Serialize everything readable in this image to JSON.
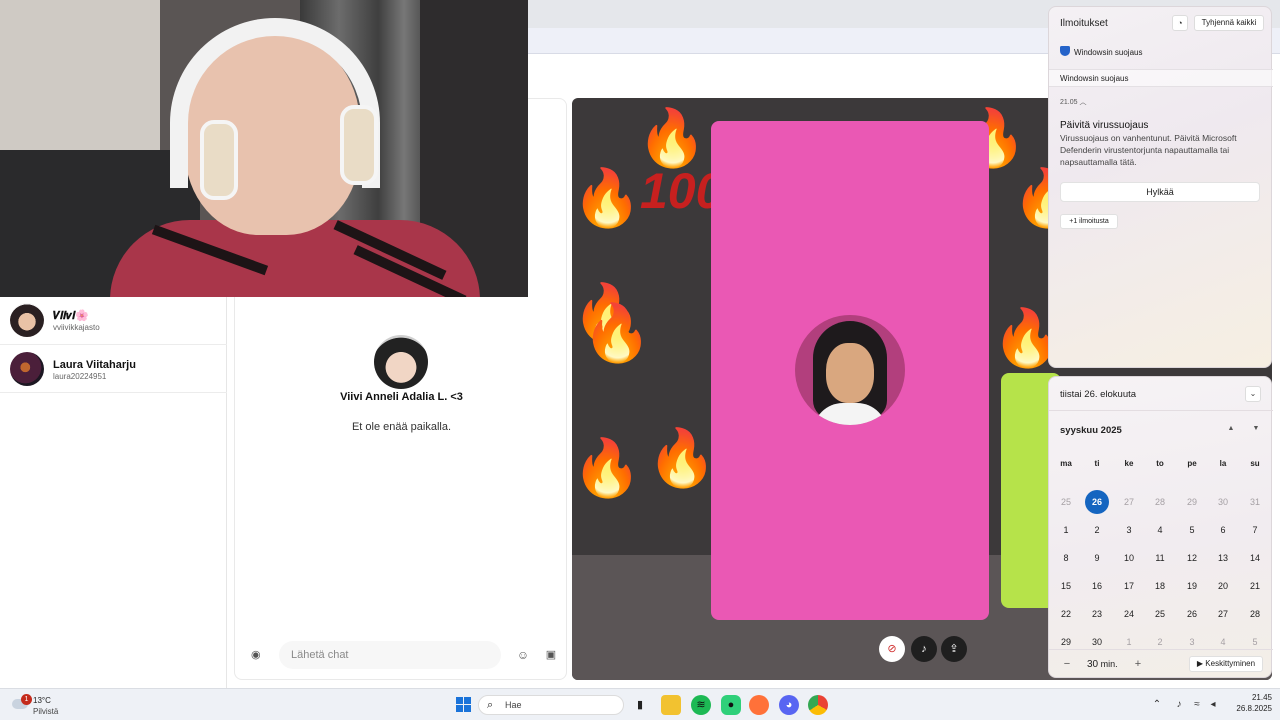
{
  "contacts": [
    {
      "name": "𝑽𝒊𝒊𝒗𝒊🌸",
      "handle": "vviivikkajasto"
    },
    {
      "name": "Laura Viitaharju",
      "handle": "laura20224951"
    }
  ],
  "chat": {
    "contact_name": "Viivi Anneli Adalia L. <3",
    "status": "Et ole enää paikalla.",
    "input_placeholder": "Lähetä chat"
  },
  "call": {
    "sticker_text": "100"
  },
  "notifications": {
    "title": "Ilmoitukset",
    "clear_all": "Tyhjennä kaikki",
    "app_name": "Windowsin suojaus",
    "group_name": "Windowsin suojaus",
    "time": "21.05",
    "heading": "Päivitä virussuojaus",
    "body": "Virussuojaus on vanhentunut. Päivitä Microsoft Defenderin virustentorjunta napauttamalla tai napsauttamalla tätä.",
    "dismiss": "Hylkää",
    "more": "+1 ilmoitusta"
  },
  "calendar": {
    "date_header": "tiistai 26. elokuuta",
    "month": "syyskuu 2025",
    "weekdays": [
      "ma",
      "ti",
      "ke",
      "to",
      "pe",
      "la",
      "su"
    ],
    "weeks": [
      [
        "25",
        "26",
        "27",
        "28",
        "29",
        "30",
        "31"
      ],
      [
        "1",
        "2",
        "3",
        "4",
        "5",
        "6",
        "7"
      ],
      [
        "8",
        "9",
        "10",
        "11",
        "12",
        "13",
        "14"
      ],
      [
        "15",
        "16",
        "17",
        "18",
        "19",
        "20",
        "21"
      ],
      [
        "22",
        "23",
        "24",
        "25",
        "26",
        "27",
        "28"
      ],
      [
        "29",
        "30",
        "1",
        "2",
        "3",
        "4",
        "5"
      ]
    ],
    "today": "26",
    "focus_minutes": "30",
    "focus_unit": "min.",
    "focus_button": "Keskittyminen"
  },
  "taskbar": {
    "weather_temp": "13°C",
    "weather_desc": "Pilvistä",
    "weather_badge": "1",
    "search_label": "Hae",
    "time": "21.45",
    "date": "26.8.2025"
  },
  "colors": {
    "pink_card": "#ea58b4",
    "green_card": "#b6e34a",
    "today_accent": "#1565c0",
    "call_background": "#3c393a"
  }
}
